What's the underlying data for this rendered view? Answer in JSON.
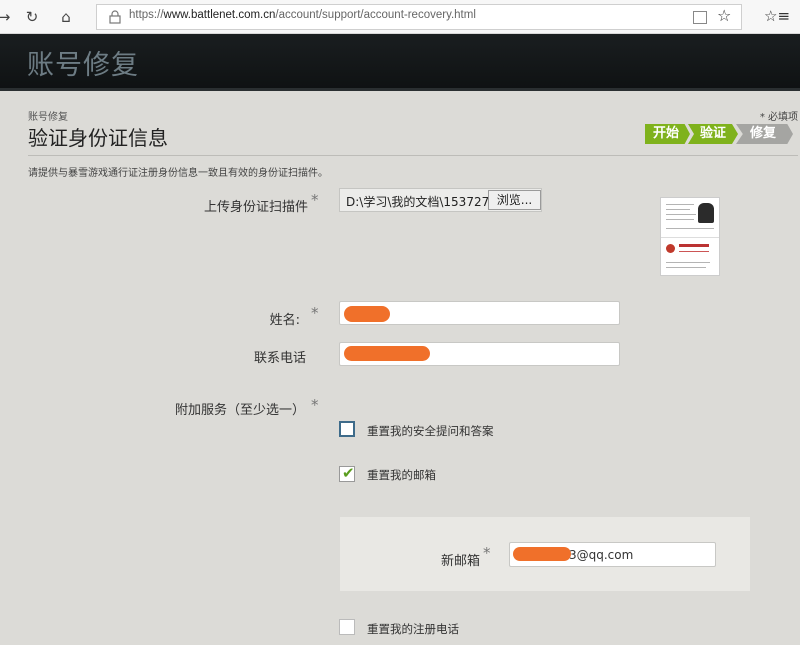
{
  "browser": {
    "url_prefix": "https://",
    "url_domain": "www.battlenet.com.cn",
    "url_path": "/account/support/account-recovery.html"
  },
  "header": {
    "title": "账号修复"
  },
  "panel": {
    "breadcrumb": "账号修复",
    "required_note": "* 必填项",
    "page_title": "验证身份证信息",
    "steps": [
      "开始",
      "验证",
      "修复"
    ],
    "intro": "请提供与暴雪游戏通行证注册身份信息一致且有效的身份证扫描件。"
  },
  "form": {
    "upload_label": "上传身份证扫描件",
    "file_path": "D:\\学习\\我的文档\\15372741",
    "browse_label": "浏览...",
    "name_label": "姓名:",
    "phone_label": "联系电话",
    "services_label": "附加服务（至少选一）",
    "required_mark": "*",
    "options": [
      {
        "label": "重置我的安全提问和答案",
        "checked": false
      },
      {
        "label": "重置我的邮箱",
        "checked": true
      },
      {
        "label": "重置我的注册电话",
        "checked": false
      }
    ],
    "new_email_label": "新邮箱",
    "new_email_value": "3@qq.com",
    "checkmark": "✔"
  },
  "colors": {
    "step_active": "#7fb21c",
    "step_inactive": "#a5a5a2",
    "redaction": "#f0702a"
  }
}
